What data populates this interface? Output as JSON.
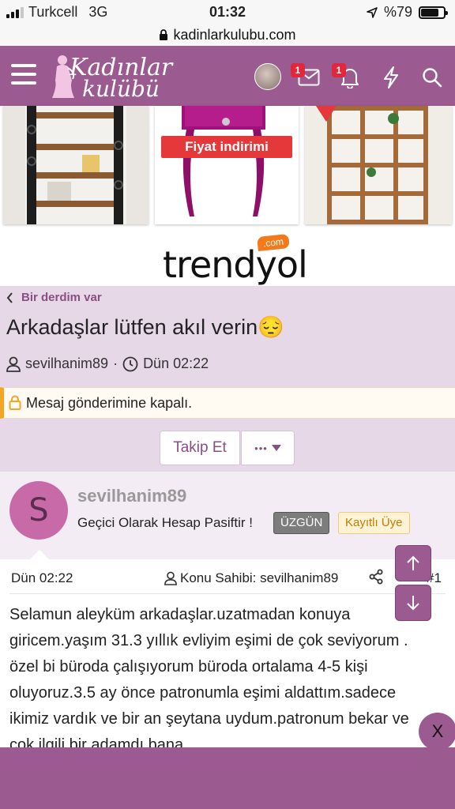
{
  "status_bar": {
    "carrier": "Turkcell",
    "network": "3G",
    "time": "01:32",
    "battery_text": "%79",
    "battery_level": 0.79
  },
  "browser": {
    "url": "kadinlarkulubu.com"
  },
  "header": {
    "logo_line1": "Kadınlar",
    "logo_line2": "kulübü",
    "message_badge": "1",
    "alert_badge": "1",
    "icons": [
      "menu-icon",
      "avatar",
      "envelope-icon",
      "bell-icon",
      "bolt-icon",
      "search-icon"
    ]
  },
  "ad": {
    "discount_label": "Fiyat indirimi",
    "brand": "trendyol",
    "brand_suffix": ".com"
  },
  "thread": {
    "breadcrumb": "Bir derdim var",
    "title": "Arkadaşlar lütfen akıl verin😔",
    "author": "sevilhanim89",
    "separator": "·",
    "date": "Dün 02:22",
    "closed_notice": "Mesaj gönderimine kapalı.",
    "follow_label": "Takip Et",
    "more_label": "•••"
  },
  "post": {
    "avatar_letter": "S",
    "author": "sevilhanim89",
    "user_title": "Geçici Olarak Hesap Pasiftir !",
    "mood_tag": "ÜZGÜN",
    "member_tag": "Kayıtlı Üye",
    "date": "Dün 02:22",
    "owner_label": "Konu Sahibi: sevilhanim89",
    "number": "#1",
    "body": "Selamun aleyküm arkadaşlar.uzatmadan konuya giricem.yaşım 31.3 yıllık evliyim eşimi de çok seviyorum . özel bi büroda çalışıyorum büroda ortalama 4-5 kişi oluyoruz.3.5 ay önce patronumla eşimi aldattım.sadece ikimiz vardık ve bir an şeytana uydum.patronum bekar ve çok ilgili bir adamdı bana"
  },
  "overlay": {
    "close_label": "X"
  },
  "colors": {
    "brand": "#9b5b91",
    "header_tint": "#e7d8e8",
    "alert": "#e2263b"
  }
}
